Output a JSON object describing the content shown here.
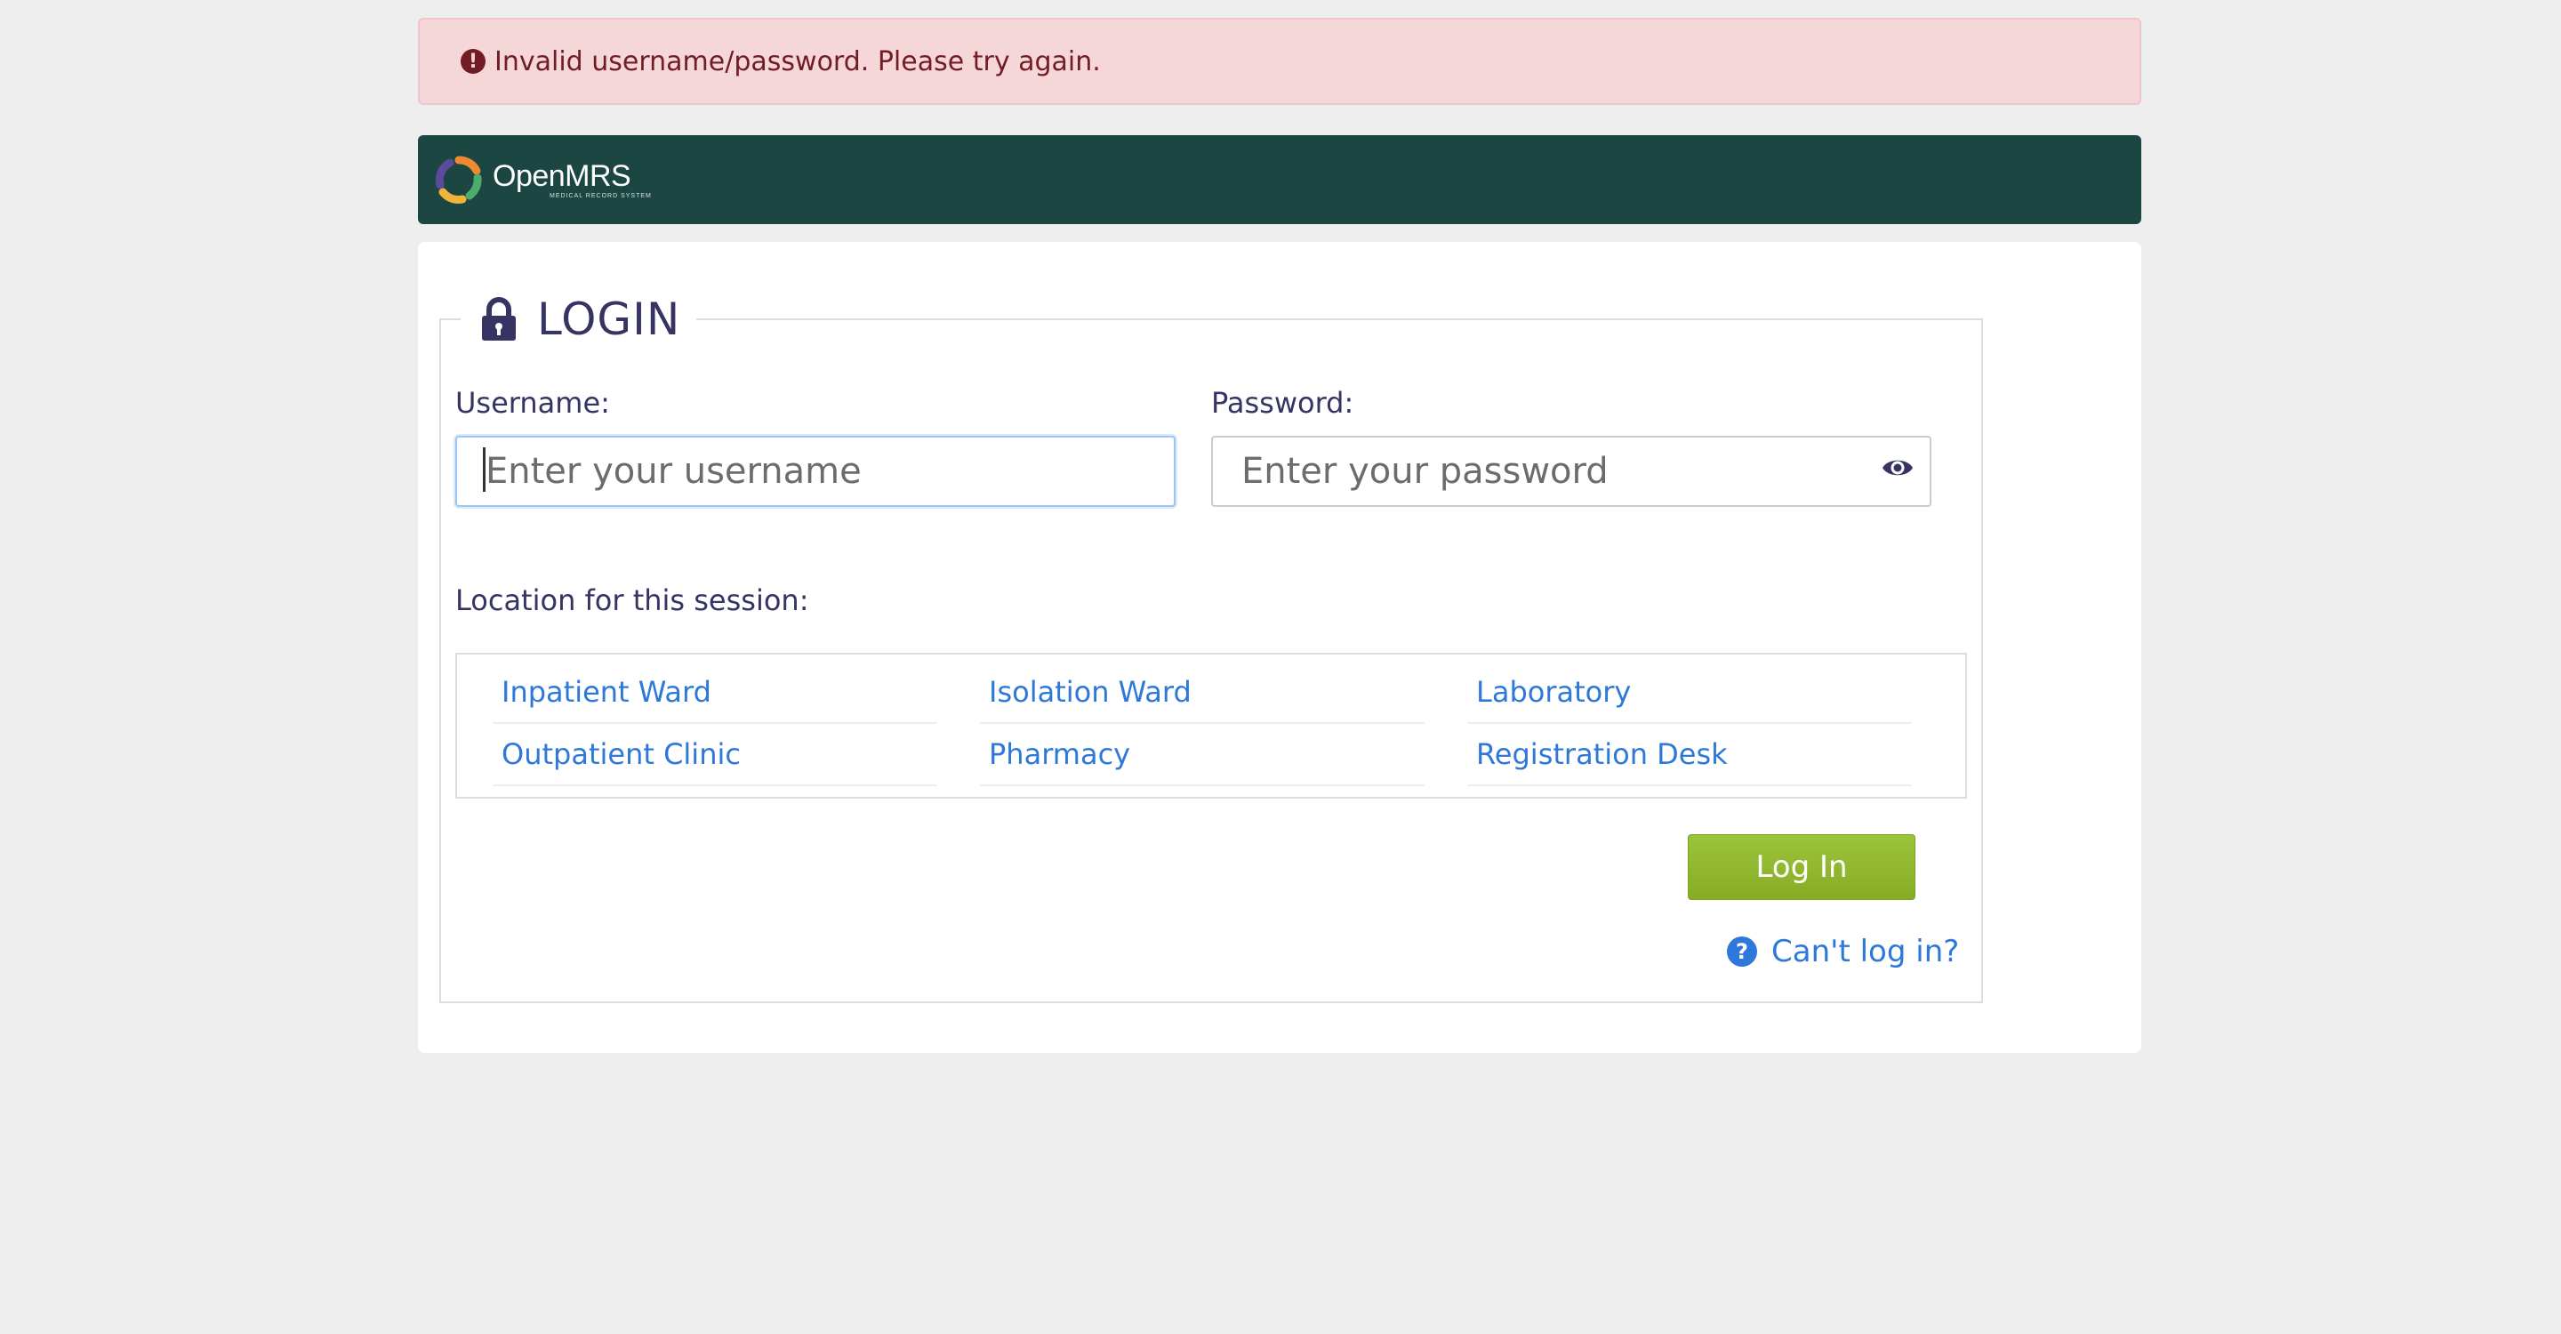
{
  "alert": {
    "icon": "exclamation-circle-icon",
    "message": "Invalid username/password. Please try again."
  },
  "header": {
    "logo_text": "OpenMRS",
    "logo_subtext": "MEDICAL RECORD SYSTEM"
  },
  "login": {
    "title": "LOGIN",
    "title_icon": "lock-icon",
    "username_label": "Username:",
    "username_value": "",
    "username_placeholder": "Enter your username",
    "password_label": "Password:",
    "password_value": "",
    "password_placeholder": "Enter your password",
    "password_toggle_icon": "eye-icon",
    "location_label": "Location for this session:",
    "locations": [
      "Inpatient Ward",
      "Isolation Ward",
      "Laboratory",
      "Outpatient Clinic",
      "Pharmacy",
      "Registration Desk"
    ],
    "login_button": "Log In",
    "cant_login_icon": "question-circle-icon",
    "cant_login_link": "Can't log in?"
  },
  "colors": {
    "page_background": "#eeeeee",
    "alert_background": "#f5d7da",
    "alert_text": "#721c24",
    "header_background": "#1c4642",
    "title_text": "#363463",
    "link": "#2e78d9",
    "button": "#88af28"
  }
}
